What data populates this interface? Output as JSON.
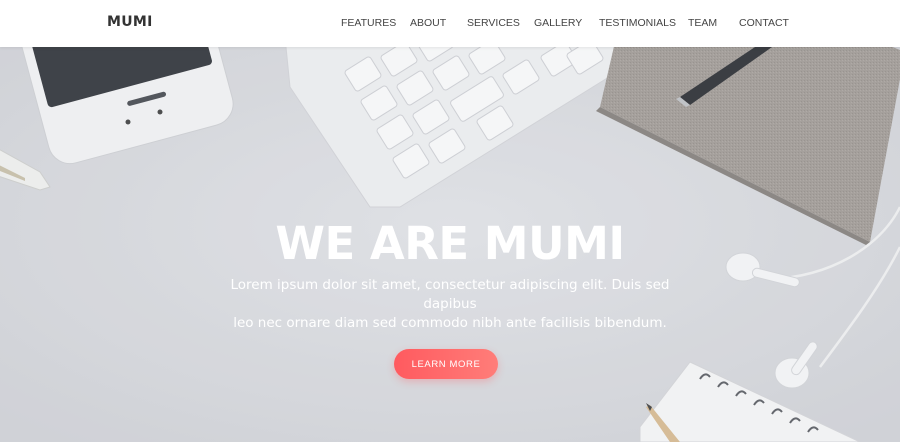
{
  "brand": {
    "name": "MUMI"
  },
  "nav": {
    "items": [
      {
        "label": "FEATURES"
      },
      {
        "label": "ABOUT"
      },
      {
        "label": "SERVICES"
      },
      {
        "label": "GALLERY"
      },
      {
        "label": "TESTIMONIALS"
      },
      {
        "label": "TEAM"
      },
      {
        "label": "CONTACT"
      }
    ]
  },
  "hero": {
    "title": "WE ARE MUMI",
    "subtitle_line1": "Lorem ipsum dolor sit amet, consectetur adipiscing elit. Duis sed dapibus",
    "subtitle_line2": "leo nec ornare diam sed commodo nibh ante facilisis bibendum.",
    "button_label": "LEARN MORE"
  },
  "colors": {
    "accent": "#ff5a5f",
    "accent_light": "#ff7d79",
    "nav_bg": "#ffffff",
    "hero_bg": "#d9dadf"
  },
  "images": {
    "hero_background": "desk-flatlay-photo"
  }
}
